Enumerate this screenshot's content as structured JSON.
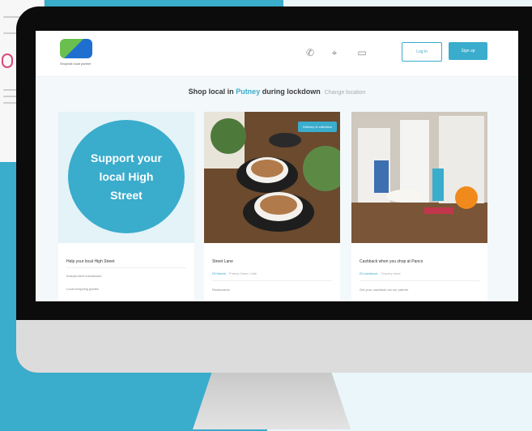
{
  "site": {
    "logo_subtitle": "Shoptalk  local partner"
  },
  "nav": {
    "login": "Log in",
    "join": "Sign up"
  },
  "headline": {
    "prefix": "Shop local in ",
    "place": "Putney",
    "suffix": " during lockdown",
    "muted": "Change location"
  },
  "cards": [
    {
      "circle_text": "Support your local High Street",
      "title": "Help your local High Street",
      "line1": "Independent businesses",
      "line2": "Local shopping guides"
    },
    {
      "badge": "Delivery & collection",
      "title": "Street Lane",
      "tag": "£5 tickets",
      "tag_extra": "Putney Green Cafe",
      "line": "Restaurants"
    },
    {
      "title": "Cashback when you shop at Panco",
      "tag": "£5 cashback",
      "tag_extra": "Grocery store",
      "line": "Get your cashback via our partner"
    }
  ],
  "colors": {
    "accent": "#3aaccc",
    "background_right": "#eaf6fa"
  }
}
